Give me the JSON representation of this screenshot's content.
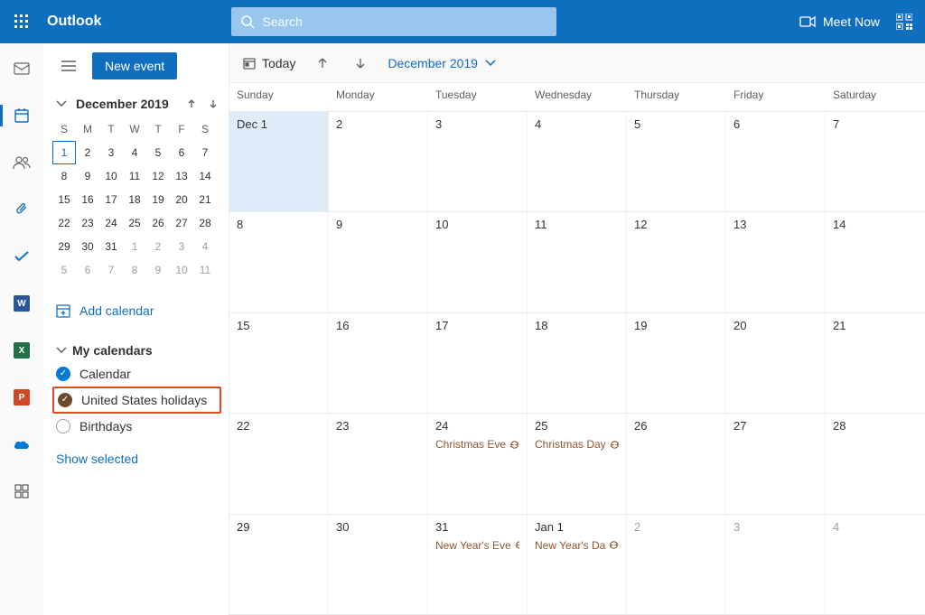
{
  "header": {
    "app_title": "Outlook",
    "search_placeholder": "Search",
    "meet_now": "Meet Now"
  },
  "sidebar": {
    "new_event": "New event",
    "mini_month": "December 2019",
    "dows": [
      "S",
      "M",
      "T",
      "W",
      "T",
      "F",
      "S"
    ],
    "weeks": [
      [
        {
          "n": "1",
          "today": true
        },
        {
          "n": "2"
        },
        {
          "n": "3"
        },
        {
          "n": "4"
        },
        {
          "n": "5"
        },
        {
          "n": "6"
        },
        {
          "n": "7"
        }
      ],
      [
        {
          "n": "8"
        },
        {
          "n": "9"
        },
        {
          "n": "10"
        },
        {
          "n": "11"
        },
        {
          "n": "12"
        },
        {
          "n": "13"
        },
        {
          "n": "14"
        }
      ],
      [
        {
          "n": "15"
        },
        {
          "n": "16"
        },
        {
          "n": "17"
        },
        {
          "n": "18"
        },
        {
          "n": "19"
        },
        {
          "n": "20"
        },
        {
          "n": "21"
        }
      ],
      [
        {
          "n": "22"
        },
        {
          "n": "23"
        },
        {
          "n": "24"
        },
        {
          "n": "25"
        },
        {
          "n": "26"
        },
        {
          "n": "27"
        },
        {
          "n": "28"
        }
      ],
      [
        {
          "n": "29"
        },
        {
          "n": "30"
        },
        {
          "n": "31"
        },
        {
          "n": "1",
          "dim": true
        },
        {
          "n": "2",
          "dim": true
        },
        {
          "n": "3",
          "dim": true
        },
        {
          "n": "4",
          "dim": true
        }
      ],
      [
        {
          "n": "5",
          "dim": true
        },
        {
          "n": "6",
          "dim": true
        },
        {
          "n": "7",
          "dim": true
        },
        {
          "n": "8",
          "dim": true
        },
        {
          "n": "9",
          "dim": true
        },
        {
          "n": "10",
          "dim": true
        },
        {
          "n": "11",
          "dim": true
        }
      ]
    ],
    "add_calendar": "Add calendar",
    "my_calendars": "My calendars",
    "calendars": [
      {
        "label": "Calendar",
        "color": "blue",
        "checked": true,
        "highlight": false
      },
      {
        "label": "United States holidays",
        "color": "brown",
        "checked": true,
        "highlight": true
      },
      {
        "label": "Birthdays",
        "color": "none",
        "checked": false,
        "highlight": false
      }
    ],
    "show_selected": "Show selected"
  },
  "toolbar": {
    "today": "Today",
    "month_label": "December 2019"
  },
  "calendar": {
    "dows": [
      "Sunday",
      "Monday",
      "Tuesday",
      "Wednesday",
      "Thursday",
      "Friday",
      "Saturday"
    ],
    "weeks": [
      [
        {
          "label": "Dec 1",
          "selected": true
        },
        {
          "label": "2"
        },
        {
          "label": "3"
        },
        {
          "label": "4"
        },
        {
          "label": "5"
        },
        {
          "label": "6"
        },
        {
          "label": "7"
        }
      ],
      [
        {
          "label": "8"
        },
        {
          "label": "9"
        },
        {
          "label": "10"
        },
        {
          "label": "11"
        },
        {
          "label": "12"
        },
        {
          "label": "13"
        },
        {
          "label": "14"
        }
      ],
      [
        {
          "label": "15"
        },
        {
          "label": "16"
        },
        {
          "label": "17"
        },
        {
          "label": "18"
        },
        {
          "label": "19"
        },
        {
          "label": "20"
        },
        {
          "label": "21"
        }
      ],
      [
        {
          "label": "22"
        },
        {
          "label": "23"
        },
        {
          "label": "24",
          "events": [
            {
              "title": "Christmas Eve"
            }
          ]
        },
        {
          "label": "25",
          "events": [
            {
              "title": "Christmas Day"
            }
          ]
        },
        {
          "label": "26"
        },
        {
          "label": "27"
        },
        {
          "label": "28"
        }
      ],
      [
        {
          "label": "29"
        },
        {
          "label": "30"
        },
        {
          "label": "31",
          "events": [
            {
              "title": "New Year's Eve"
            }
          ]
        },
        {
          "label": "Jan 1",
          "dim": false,
          "events": [
            {
              "title": "New Year's Da"
            }
          ]
        },
        {
          "label": "2",
          "dim": true
        },
        {
          "label": "3",
          "dim": true
        },
        {
          "label": "4",
          "dim": true
        }
      ]
    ]
  }
}
